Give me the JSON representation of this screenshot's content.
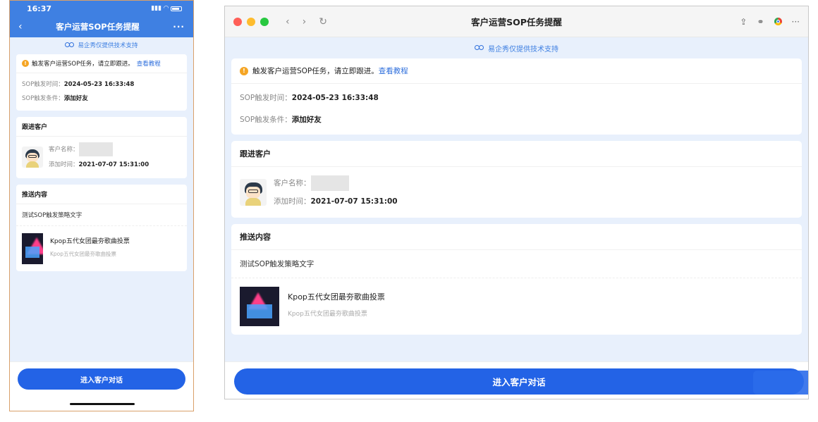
{
  "phone": {
    "status_time": "16:37",
    "nav_title": "客户运营SOP任务提醒",
    "back_icon": "‹",
    "more_icon": "···"
  },
  "support_text": "易企秀仅提供技术支持",
  "alert": {
    "text": "触发客户运营SOP任务，请立即跟进。",
    "link": "查看教程"
  },
  "sop": {
    "trigger_time_label": "SOP触发时间：",
    "trigger_time": "2024-05-23 16:33:48",
    "trigger_cond_label": "SOP触发条件：",
    "trigger_cond": "添加好友"
  },
  "customer": {
    "section_title": "跟进客户",
    "name_label": "客户名称：",
    "add_time_label": "添加时间：",
    "add_time": "2021-07-07 15:31:00"
  },
  "push": {
    "section_title": "推送内容",
    "strategy_text": "测试SOP触发策略文字",
    "item_title": "Kpop五代女团最夯歌曲投票",
    "item_subtitle": "Kpop五代女团最夯歌曲投票"
  },
  "enter_button": "进入客户对话",
  "window": {
    "title": "客户运营SOP任务提醒",
    "nav_back": "‹",
    "nav_forward": "›",
    "nav_reload": "↻",
    "share_icon": "⇪",
    "link_icon": "⚭",
    "more_icon": "···",
    "dot_colors": [
      "#ff5f57",
      "#febc2e",
      "#28c840"
    ]
  },
  "colors": {
    "primary": "#2363e6",
    "header_blue": "#3f80e2",
    "bg_blue": "#e8f0fc",
    "warn": "#f5a524"
  }
}
